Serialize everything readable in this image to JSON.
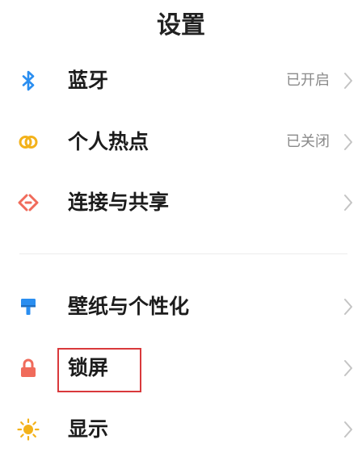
{
  "header": {
    "title": "设置"
  },
  "groups": [
    {
      "items": [
        {
          "label": "蓝牙",
          "status": "已开启",
          "icon": "bluetooth-icon",
          "color": "#2a8ef0"
        },
        {
          "label": "个人热点",
          "status": "已关闭",
          "icon": "hotspot-icon",
          "color": "#f3b21b"
        },
        {
          "label": "连接与共享",
          "status": "",
          "icon": "connection-share-icon",
          "color": "#f06b5b"
        }
      ]
    },
    {
      "items": [
        {
          "label": "壁纸与个性化",
          "status": "",
          "icon": "paintbrush-icon",
          "color": "#2a8ef0"
        },
        {
          "label": "锁屏",
          "status": "",
          "icon": "lock-icon",
          "color": "#f06b5b",
          "highlighted": true
        },
        {
          "label": "显示",
          "status": "",
          "icon": "sun-icon",
          "color": "#f3b21b"
        }
      ]
    }
  ],
  "colors": {
    "highlight": "#d9393b",
    "status_text": "#8a8a8a",
    "chevron": "#c4c4c4"
  }
}
